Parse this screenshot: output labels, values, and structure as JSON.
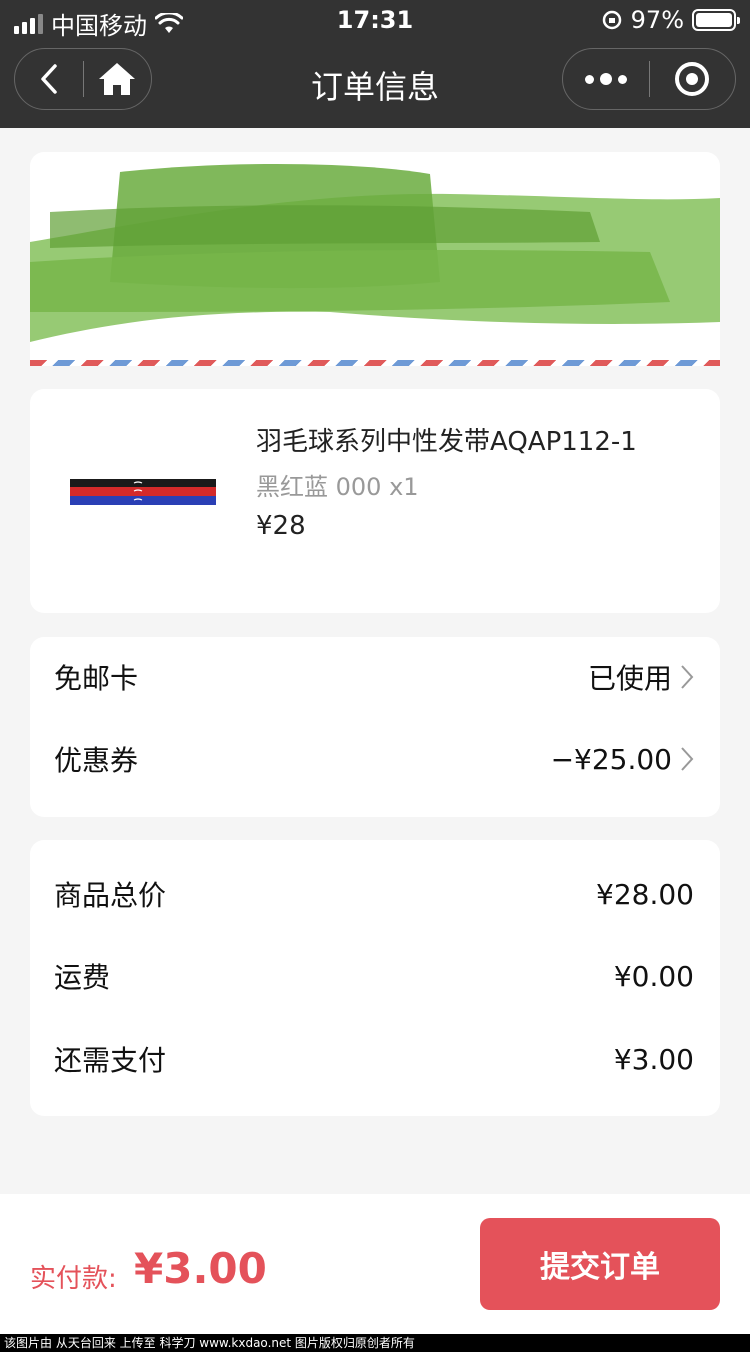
{
  "status_bar": {
    "carrier": "中国移动",
    "time": "17:31",
    "battery": "97%"
  },
  "nav": {
    "title": "订单信息",
    "back_icon": "chevron-left-icon",
    "home_icon": "home-icon",
    "more_icon": "more-dots-icon",
    "close_icon": "capsule-target-icon"
  },
  "product": {
    "name": "羽毛球系列中性发带AQAP112-1",
    "spec": "黑红蓝 000 x1",
    "price": "¥28"
  },
  "discounts": [
    {
      "label": "免邮卡",
      "value": "已使用"
    },
    {
      "label": "优惠券",
      "value": "−¥25.00"
    }
  ],
  "summary": [
    {
      "label": "商品总价",
      "value": "¥28.00"
    },
    {
      "label": "运费",
      "value": "¥0.00"
    },
    {
      "label": "还需支付",
      "value": "¥3.00"
    }
  ],
  "footer": {
    "pay_label": "实付款:",
    "pay_amount": "¥3.00",
    "submit_label": "提交订单"
  },
  "watermark": "该图片由 从天台回来 上传至 科学刀 www.kxdao.net 图片版权归原创者所有",
  "colors": {
    "accent": "#e4525a",
    "topbar": "#333333",
    "page_bg": "#f5f5f5"
  }
}
